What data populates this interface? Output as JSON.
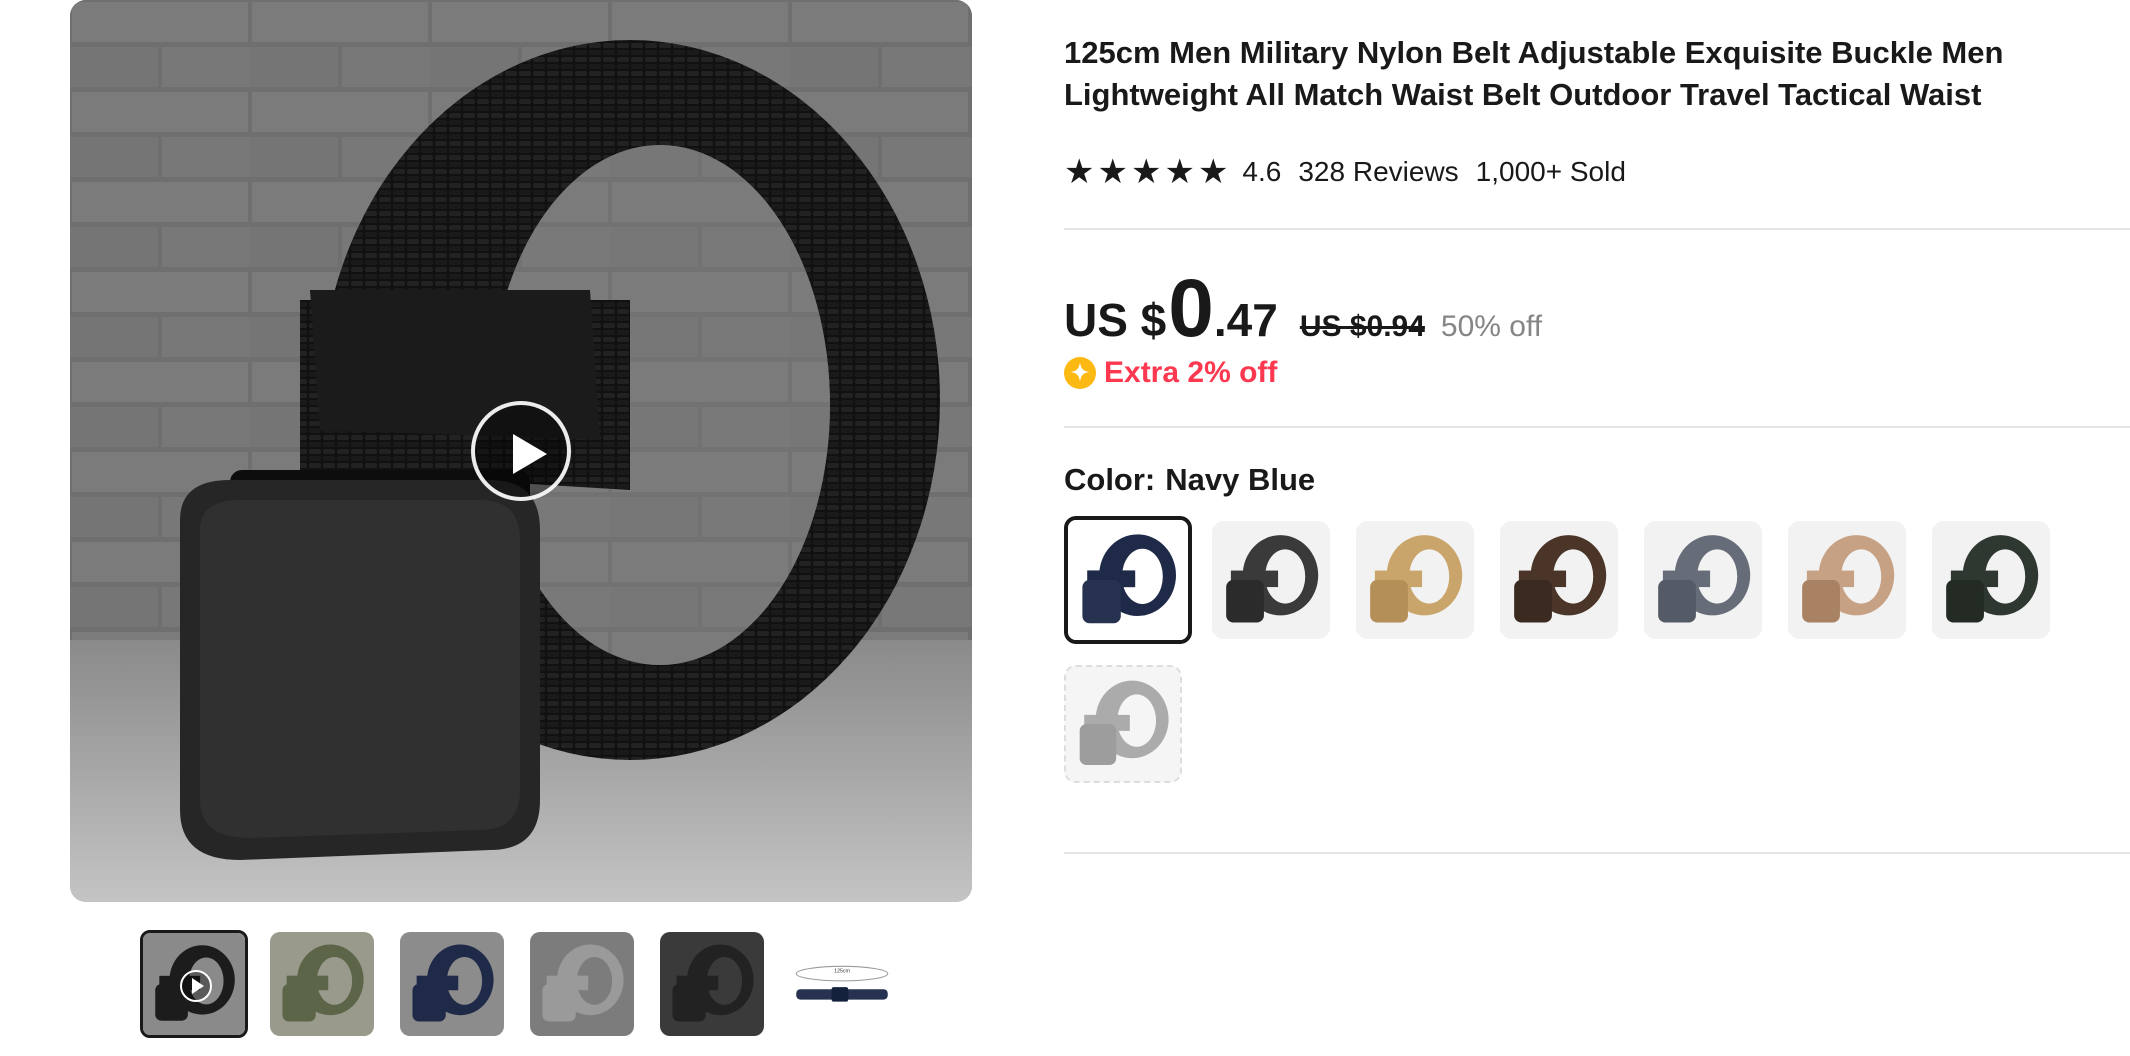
{
  "product": {
    "title": "125cm Men Military Nylon Belt Adjustable Exquisite Buckle Men Lightweight All Match Waist Belt Outdoor Travel Tactical Waist",
    "rating": {
      "stars_filled": 5,
      "value": "4.6",
      "reviews_label": "328 Reviews",
      "sold_label": "1,000+ Sold"
    },
    "price": {
      "prefix": "US $",
      "integer": "0",
      "decimal": ".47",
      "original": "US $0.94",
      "discount": "50% off"
    },
    "extra_offer": {
      "icon": "coin-icon",
      "icon_glyph": "✦",
      "label": "Extra 2% off"
    },
    "color": {
      "label": "Color:",
      "selected": "Navy Blue",
      "options": [
        {
          "name": "Navy Blue",
          "strap": "#1e2a48",
          "buckle": "#26324f",
          "selected": true,
          "available": true
        },
        {
          "name": "Black",
          "strap": "#3a3a3a",
          "buckle": "#2b2b2b",
          "selected": false,
          "available": true
        },
        {
          "name": "Khaki",
          "strap": "#c9a56b",
          "buckle": "#b48f57",
          "selected": false,
          "available": true
        },
        {
          "name": "Brown",
          "strap": "#4a3528",
          "buckle": "#3b2a20",
          "selected": false,
          "available": true
        },
        {
          "name": "Grey Blue",
          "strap": "#676d78",
          "buckle": "#555b66",
          "selected": false,
          "available": true
        },
        {
          "name": "Beige",
          "strap": "#c7a184",
          "buckle": "#a98263",
          "selected": false,
          "available": true
        },
        {
          "name": "Army Green",
          "strap": "#2f3830",
          "buckle": "#242b25",
          "selected": false,
          "available": true
        },
        {
          "name": "Grey",
          "strap": "#8f8f8f",
          "buckle": "#7d7d7d",
          "selected": false,
          "available": false
        }
      ]
    }
  },
  "gallery": {
    "main_image": "black-tactical-belt-photo",
    "has_video": true,
    "thumbnails": [
      {
        "name": "black belt video",
        "strap": "#1c1c1c",
        "bg": "#8a8a8a",
        "active": true,
        "video": true,
        "caption": ""
      },
      {
        "name": "army green belt",
        "strap": "#5c6548",
        "bg": "#9a9a8c",
        "active": false,
        "video": false,
        "caption": ""
      },
      {
        "name": "navy belt",
        "strap": "#1e2a48",
        "bg": "#8c8c8c",
        "active": false,
        "video": false,
        "caption": ""
      },
      {
        "name": "grey belt",
        "strap": "#9a9a9a",
        "bg": "#7c7c7c",
        "active": false,
        "video": false,
        "caption": ""
      },
      {
        "name": "buckle close-up",
        "strap": "#222222",
        "bg": "#3a3a3a",
        "active": false,
        "video": false,
        "caption": ""
      },
      {
        "name": "length diagram",
        "strap": "#26324f",
        "bg": "#ffffff",
        "active": false,
        "video": false,
        "caption": "125cm"
      }
    ]
  }
}
